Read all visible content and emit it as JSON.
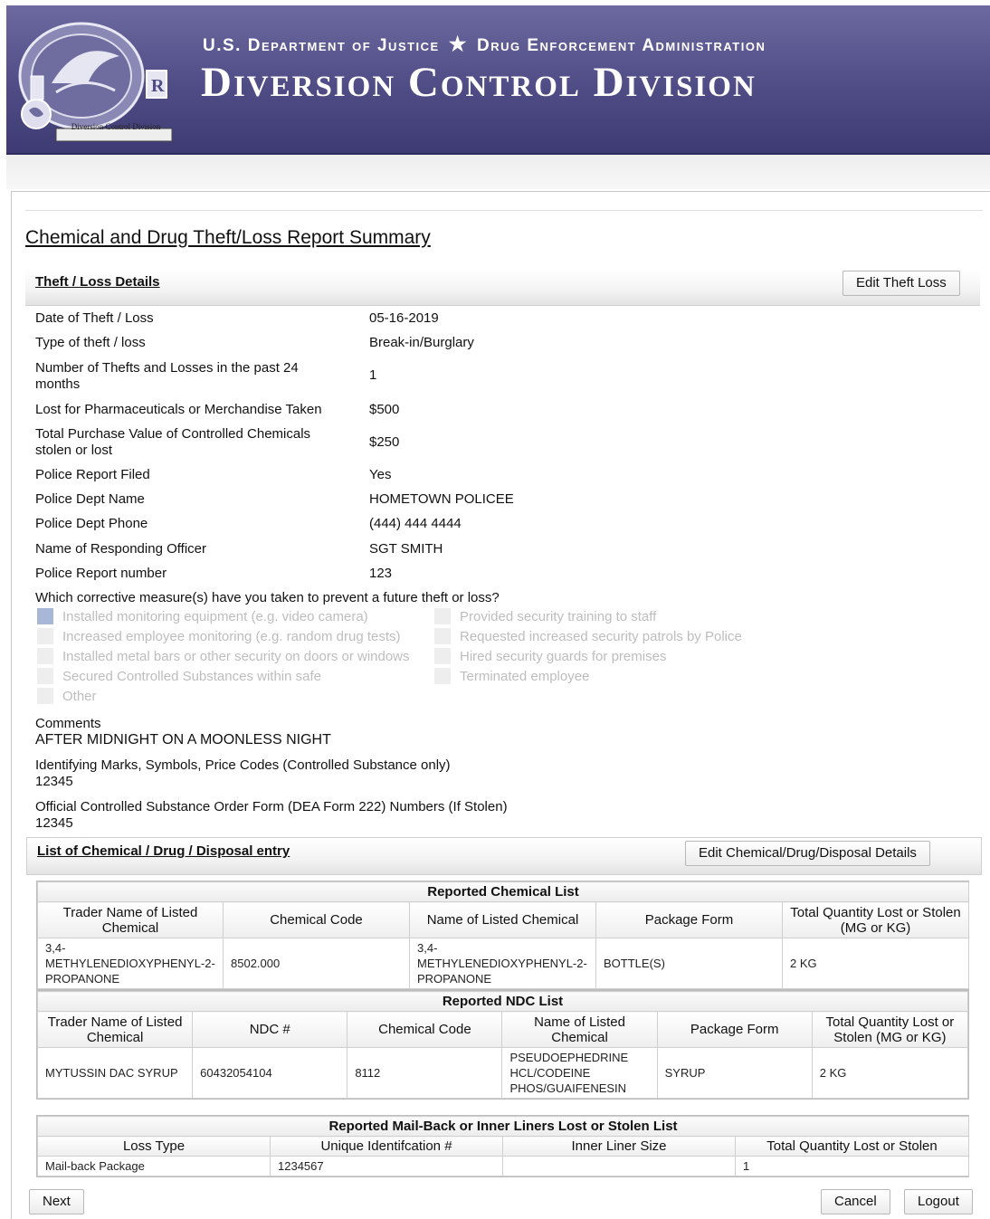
{
  "header": {
    "agency": "U.S. Department of Justice",
    "star": "★",
    "sub_agency": "Drug Enforcement Administration",
    "division": "Diversion Control Division",
    "seal_caption": "Diversion Control Division"
  },
  "page_title": "Chemical and Drug Theft/Loss Report Summary",
  "theft_loss": {
    "section_label": "Theft / Loss Details",
    "edit_button": "Edit Theft Loss",
    "fields": [
      {
        "label": "Date of Theft / Loss",
        "value": "05-16-2019"
      },
      {
        "label": "Type of theft / loss",
        "value": "Break-in/Burglary"
      },
      {
        "label": "Number of Thefts and Losses in the past 24 months",
        "value": "1"
      },
      {
        "label": "Lost for Pharmaceuticals or Merchandise Taken",
        "value": "$500"
      },
      {
        "label": "Total Purchase Value of Controlled Chemicals stolen or lost",
        "value": "$250"
      },
      {
        "label": "Police Report Filed",
        "value": "Yes"
      },
      {
        "label": "Police Dept Name",
        "value": "HOMETOWN POLICEE"
      },
      {
        "label": "Police Dept Phone",
        "value": "(444) 444 4444"
      },
      {
        "label": "Name of Responding Officer",
        "value": "SGT SMITH"
      },
      {
        "label": "Police Report number",
        "value": "123"
      }
    ],
    "corrective_question": "Which corrective measure(s) have you taken to prevent a future theft or loss?",
    "measures_left": [
      {
        "label": "Installed monitoring equipment (e.g. video camera)",
        "checked": true
      },
      {
        "label": "Increased employee monitoring (e.g. random drug tests)",
        "checked": false
      },
      {
        "label": "Installed metal bars or other security on doors or windows",
        "checked": false
      },
      {
        "label": "Secured Controlled Substances within safe",
        "checked": false
      },
      {
        "label": "Other",
        "checked": false
      }
    ],
    "measures_right": [
      {
        "label": "Provided security training to staff",
        "checked": false
      },
      {
        "label": "Requested increased security patrols by Police",
        "checked": false
      },
      {
        "label": "Hired security guards for premises",
        "checked": false
      },
      {
        "label": "Terminated employee",
        "checked": false
      }
    ],
    "comments_label": "Comments",
    "comments_value": "AFTER MIDNIGHT ON A MOONLESS NIGHT",
    "marks_label": "Identifying Marks, Symbols, Price Codes (Controlled Substance only)",
    "marks_value": "12345",
    "form222_label": "Official Controlled Substance Order Form (DEA Form 222) Numbers (If Stolen)",
    "form222_value": "12345"
  },
  "entries": {
    "section_label": "List of Chemical / Drug / Disposal entry",
    "edit_button": "Edit Chemical/Drug/Disposal Details",
    "chemical_table": {
      "caption": "Reported Chemical List",
      "headers": [
        "Trader Name of Listed Chemical",
        "Chemical Code",
        "Name of Listed Chemical",
        "Package Form",
        "Total Quantity Lost or Stolen (MG or KG)"
      ],
      "rows": [
        [
          "3,4-METHYLENEDIOXYPHENYL-2-PROPANONE",
          "8502.000",
          "3,4-METHYLENEDIOXYPHENYL-2-PROPANONE",
          "BOTTLE(S)",
          "2 KG"
        ]
      ]
    },
    "ndc_table": {
      "caption": "Reported NDC List",
      "headers": [
        "Trader Name of Listed Chemical",
        "NDC #",
        "Chemical Code",
        "Name of Listed Chemical",
        "Package Form",
        "Total Quantity Lost or Stolen (MG or KG)"
      ],
      "rows": [
        [
          "MYTUSSIN DAC SYRUP",
          "60432054104",
          "8112",
          "PSEUDOEPHEDRINE HCL/CODEINE PHOS/GUAIFENESIN",
          "SYRUP",
          "2 KG"
        ]
      ]
    },
    "mailback_table": {
      "caption": "Reported Mail-Back or Inner Liners Lost or Stolen List",
      "headers": [
        "Loss Type",
        "Unique Identifcation #",
        "Inner Liner Size",
        "Total Quantity Lost or Stolen"
      ],
      "rows": [
        [
          "Mail-back Package",
          "1234567",
          "",
          "1"
        ]
      ]
    }
  },
  "footer": {
    "next": "Next",
    "cancel": "Cancel",
    "logout": "Logout"
  }
}
